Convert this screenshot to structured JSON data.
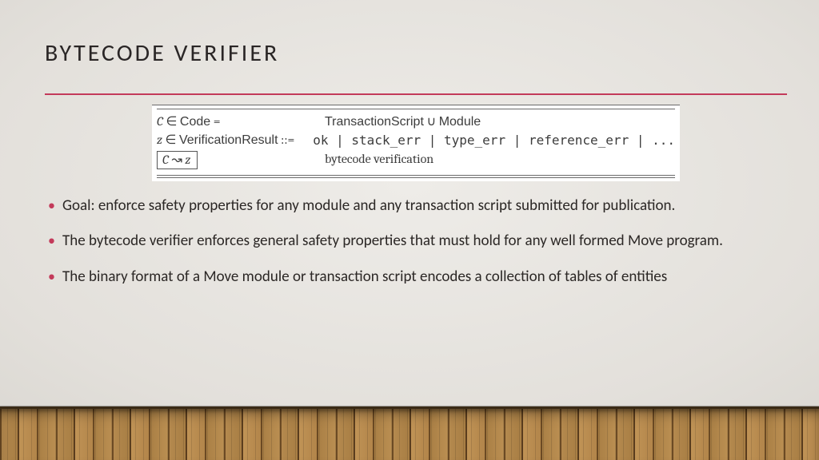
{
  "title": "BYTECODE VERIFIER",
  "def": {
    "r1_lhs_sym": "C",
    "r1_lhs_mem": "∈",
    "r1_lhs_set": "Code",
    "r1_lhs_eq": "=",
    "r1_rhs_a": "TransactionScript",
    "r1_rhs_cup": "∪",
    "r1_rhs_b": "Module",
    "r2_lhs_sym": "z",
    "r2_lhs_mem": "∈",
    "r2_lhs_set": "VerificationResult",
    "r2_lhs_bnf": "::=",
    "r2_rhs": "ok | stack_err | type_err | reference_err | ...",
    "r3_lhs_a": "C",
    "r3_lhs_arrow": "↝",
    "r3_lhs_b": "z",
    "r3_rhs": "bytecode verification"
  },
  "bullets": {
    "b1": "Goal: enforce safety properties for any module and any transaction script submitted for publication.",
    "b2": "The bytecode verifier enforces general safety properties that must hold for any well formed Move program.",
    "b3": "The binary format of a Move module or transaction script encodes a collection of tables of entities"
  }
}
